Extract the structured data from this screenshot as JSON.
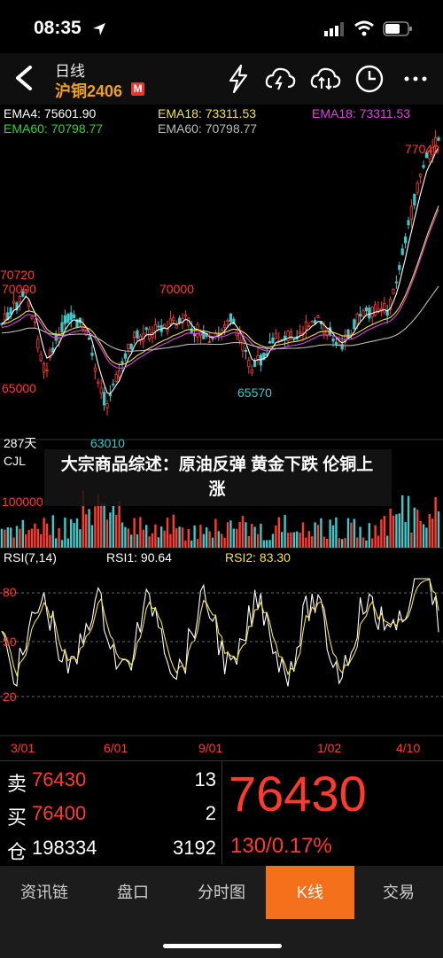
{
  "status": {
    "time": "08:35"
  },
  "header": {
    "period": "日线",
    "symbol": "沪铜2406",
    "badge": "M"
  },
  "legend": {
    "row1": [
      {
        "text": "EMA4: 75601.90",
        "color": "#ffffff"
      },
      {
        "text": "EMA18: 73311.53",
        "color": "#f2e24a"
      },
      {
        "text": "EMA18: 73311.53",
        "color": "#e040e0"
      }
    ],
    "row2": [
      {
        "text": "EMA60: 70798.77",
        "color": "#39d03a"
      },
      {
        "text": "EMA60: 70798.77",
        "color": "#bbbbbb"
      }
    ]
  },
  "price_labels": {
    "top": "77040",
    "high_left": "70720",
    "mid_left": "70000",
    "mid_center": "70000",
    "low_left": "65000",
    "low_center": "65570",
    "bottom": "63010",
    "days": "287天"
  },
  "volume": {
    "name": "CJL",
    "level": "100000"
  },
  "rsi": {
    "name": "RSI(7,14)",
    "rsi1": "RSI1: 90.64",
    "rsi2": "RSI2: 83.30",
    "levels": [
      "80",
      "50",
      "20"
    ]
  },
  "dates": [
    "3/01",
    "6/01",
    "9/01",
    "1/02",
    "4/10"
  ],
  "quote": {
    "sell_label": "卖",
    "sell_price": "76430",
    "sell_vol": "13",
    "buy_label": "买",
    "buy_price": "76400",
    "buy_vol": "2",
    "pos_label": "仓",
    "pos_value": "198334",
    "pos_change": "3192",
    "last": "76430",
    "change": "130/0.17%"
  },
  "tabs": [
    "资讯链",
    "盘口",
    "分时图",
    "K线",
    "交易"
  ],
  "active_tab": "K线",
  "overlay": {
    "headline": "大宗商品综述：原油反弹 黄金下跌 伦铜上涨"
  },
  "colors": {
    "up": "#ff3b30",
    "down": "#3cc9c9",
    "accent": "#f5701a",
    "gold": "#f0a020"
  }
}
